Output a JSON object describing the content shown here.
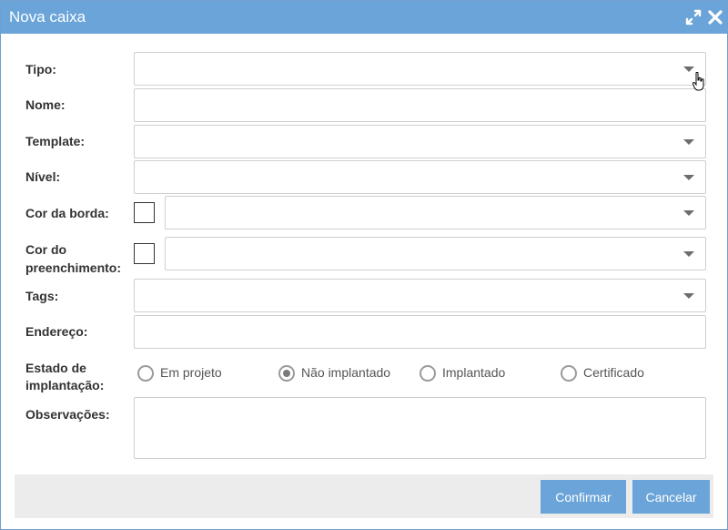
{
  "dialog": {
    "title": "Nova caixa",
    "icons": {
      "maximize": "expand-icon",
      "close": "close-icon"
    }
  },
  "form": {
    "tipo": {
      "label": "Tipo:",
      "value": ""
    },
    "nome": {
      "label": "Nome:",
      "value": ""
    },
    "template": {
      "label": "Template:",
      "value": ""
    },
    "nivel": {
      "label": "Nível:",
      "value": ""
    },
    "cor_borda": {
      "label": "Cor da borda:",
      "value": "",
      "swatch_color": "#ffffff"
    },
    "cor_preenchimento": {
      "label_line1": "Cor do",
      "label_line2": "preenchimento:",
      "value": "",
      "swatch_color": "#ffffff"
    },
    "tags": {
      "label": "Tags:",
      "value": ""
    },
    "endereco": {
      "label": "Endereço:",
      "value": ""
    },
    "estado": {
      "label_line1": "Estado de",
      "label_line2": "implantação:",
      "options": [
        {
          "label": "Em projeto",
          "selected": false
        },
        {
          "label": "Não implantado",
          "selected": true
        },
        {
          "label": "Implantado",
          "selected": false
        },
        {
          "label": "Certificado",
          "selected": false
        }
      ]
    },
    "observacoes": {
      "label": "Observações:",
      "value": ""
    }
  },
  "footer": {
    "confirm_label": "Confirmar",
    "cancel_label": "Cancelar"
  },
  "colors": {
    "accent": "#6aa4d8",
    "footer_bg": "#ececec",
    "field_border": "#cfcfcf"
  }
}
